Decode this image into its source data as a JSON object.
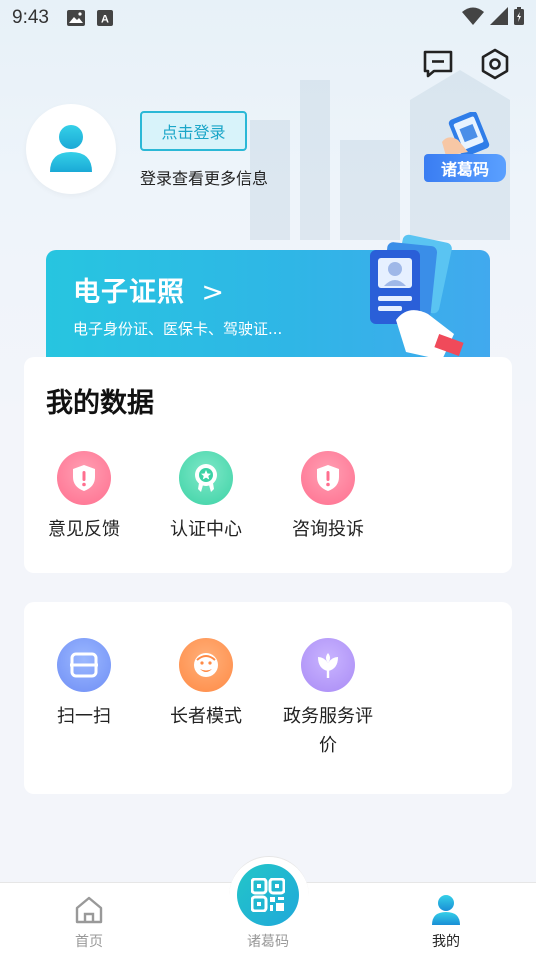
{
  "status_bar": {
    "time": "9:43"
  },
  "profile": {
    "login_button": "点击登录",
    "login_hint": "登录查看更多信息"
  },
  "qr_badge": {
    "label": "诸葛码"
  },
  "cert_banner": {
    "title": "电子证照",
    "arrow": ">",
    "subtitle": "电子身份证、医保卡、驾驶证..."
  },
  "my_data": {
    "title": "我的数据",
    "items": [
      {
        "label": "意见反馈",
        "icon": "shield-alert-icon"
      },
      {
        "label": "认证中心",
        "icon": "certificate-badge-icon"
      },
      {
        "label": "咨询投诉",
        "icon": "shield-alert-icon"
      }
    ]
  },
  "tools": {
    "items": [
      {
        "label": "扫一扫",
        "icon": "scan-icon"
      },
      {
        "label": "长者模式",
        "icon": "elder-face-icon"
      },
      {
        "label_line1": "政务服务评",
        "label_line2": "价",
        "icon": "flower-icon"
      }
    ]
  },
  "bottom_nav": {
    "items": [
      {
        "label": "首页",
        "icon": "home-icon"
      },
      {
        "label": "诸葛码",
        "icon": "qr-code-icon"
      },
      {
        "label": "我的",
        "icon": "user-icon"
      }
    ],
    "active": "我的"
  },
  "colors": {
    "accent": "#2bb8d6",
    "banner_start": "#27c5e0",
    "banner_end": "#41a9ee",
    "qr_badge": "#3a7df2"
  }
}
